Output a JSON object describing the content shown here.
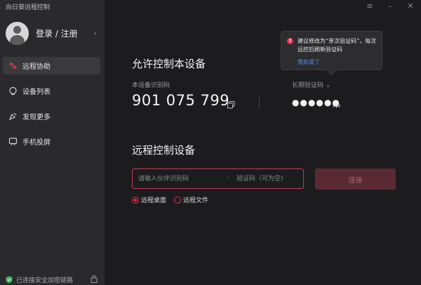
{
  "app": {
    "title": "向日葵远程控制"
  },
  "window_controls": {
    "menu": "≡",
    "minimize": "–",
    "close": "✕"
  },
  "sidebar": {
    "login_label": "登录 / 注册",
    "items": [
      {
        "label": "远程协助",
        "icon": "remote-assist-icon",
        "active": true
      },
      {
        "label": "设备列表",
        "icon": "device-list-icon",
        "active": false
      },
      {
        "label": "发现更多",
        "icon": "discover-icon",
        "active": false
      },
      {
        "label": "手机投屏",
        "icon": "screen-cast-icon",
        "active": false
      }
    ],
    "security_status": "已连接安全加密链路"
  },
  "allow_control": {
    "title": "允许控制本设备",
    "id_label": "本设备识别码",
    "device_id": "901 075 799",
    "code_type_label": "长期验证码",
    "code_masked": "●●●●●●"
  },
  "tooltip": {
    "text": "建议修改为“单次验证码”，每次远控后刷新验证码",
    "link": "我知道了"
  },
  "remote_control": {
    "title": "远程控制设备",
    "partner_placeholder": "请输入伙伴识别码",
    "separator": "-",
    "code_placeholder": "验证码（可为空)",
    "connect_label": "连接",
    "options": [
      {
        "label": "远程桌面",
        "checked": true
      },
      {
        "label": "远程文件",
        "checked": false
      }
    ]
  },
  "colors": {
    "accent": "#e8345a",
    "sidebar_bg": "#2a2a2c",
    "main_bg": "#1c1c1e",
    "link": "#4d8ff0"
  }
}
